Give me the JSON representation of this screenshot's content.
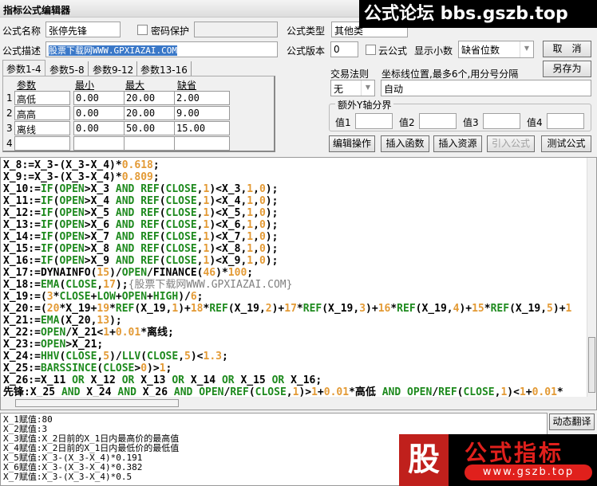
{
  "window": {
    "title": "指标公式编辑器"
  },
  "form": {
    "name_label": "公式名称",
    "name_value": "张停先锋",
    "password_label": "密码保护",
    "password_checked": false,
    "type_label": "公式类型",
    "type_value": "其他类",
    "desc_label": "公式描述",
    "desc_value": "股票下载网WWW.GPXIAZAI.COM",
    "version_label": "公式版本",
    "version_value": "0",
    "cloud_label": "云公式",
    "cloud_checked": false,
    "decimals_label": "显示小数",
    "decimals_value": "缺省位数",
    "cancel_label": "取　消",
    "saveas_label": "另存为",
    "trade_rule_label": "交易法则",
    "trade_rule_value": "无",
    "axis_label": "坐标线位置,最多6个,用分号分隔",
    "axis_value": "自动",
    "yaxis_group_label": "额外Y轴分界",
    "yaxis_values": [
      {
        "label": "值1",
        "value": ""
      },
      {
        "label": "值2",
        "value": ""
      },
      {
        "label": "值3",
        "value": ""
      },
      {
        "label": "值4",
        "value": ""
      }
    ]
  },
  "tabs": [
    "参数1-4",
    "参数5-8",
    "参数9-12",
    "参数13-16"
  ],
  "params": {
    "headers": [
      "参数",
      "最小",
      "最大",
      "缺省"
    ],
    "rows": [
      {
        "no": "1",
        "name": "高低",
        "min": "0.00",
        "max": "20.00",
        "def": "2.00"
      },
      {
        "no": "2",
        "name": "高高",
        "min": "0.00",
        "max": "20.00",
        "def": "9.00"
      },
      {
        "no": "3",
        "name": "离线",
        "min": "0.00",
        "max": "50.00",
        "def": "15.00"
      },
      {
        "no": "4",
        "name": "",
        "min": "",
        "max": "",
        "def": ""
      }
    ]
  },
  "toolbar": [
    "编辑操作",
    "插入函数",
    "插入资源",
    "引入公式",
    "测试公式"
  ],
  "code_lines": [
    "X_8:=X_3-(X_3-X_4)*0.618;",
    "X_9:=X_3-(X_3-X_4)*0.809;",
    "X_10:=IF(OPEN>X_3 AND REF(CLOSE,1)<X_3,1,0);",
    "X_11:=IF(OPEN>X_4 AND REF(CLOSE,1)<X_4,1,0);",
    "X_12:=IF(OPEN>X_5 AND REF(CLOSE,1)<X_5,1,0);",
    "X_13:=IF(OPEN>X_6 AND REF(CLOSE,1)<X_6,1,0);",
    "X_14:=IF(OPEN>X_7 AND REF(CLOSE,1)<X_7,1,0);",
    "X_15:=IF(OPEN>X_8 AND REF(CLOSE,1)<X_8,1,0);",
    "X_16:=IF(OPEN>X_9 AND REF(CLOSE,1)<X_9,1,0);",
    "X_17:=DYNAINFO(15)/OPEN/FINANCE(46)*100;",
    "X_18:=EMA(CLOSE,17);{股票下载网WWW.GPXIAZAI.COM}",
    "X_19:=(3*CLOSE+LOW+OPEN+HIGH)/6;",
    "X_20:=(20*X_19+19*REF(X_19,1)+18*REF(X_19,2)+17*REF(X_19,3)+16*REF(X_19,4)+15*REF(X_19,5)+1",
    "X_21:=EMA(X_20,13);",
    "X_22:=OPEN/X_21<1+0.01*离线;",
    "X_23:=OPEN>X_21;",
    "X_24:=HHV(CLOSE,5)/LLV(CLOSE,5)<1.3;",
    "X_25:=BARSSINCE(CLOSE>0)>1;",
    "X_26:=X_11 OR X_12 OR X_13 OR X_14 OR X_15 OR X_16;",
    "先锋:X_25 AND X_24 AND X_26 AND OPEN/REF(CLOSE,1)>1+0.01*高低 AND OPEN/REF(CLOSE,1)<1+0.01*"
  ],
  "output_lines": [
    "X_1赋值:80",
    "X_2赋值:3",
    "X_3赋值:X_2日前的X_1日内最高价的最高值",
    "X_4赋值:X_2日前的X_1日内最低价的最低值",
    "X_5赋值:X_3-(X_3-X_4)*0.191",
    "X_6赋值:X_3-(X_3-X_4)*0.382",
    "X_7赋值:X_3-(X_3-X_4)*0.5"
  ],
  "translate_button": "动态翻译",
  "watermarks": {
    "top": "公式论坛 bbs.gszb.top",
    "logo_char": "股",
    "logo_title": "公式指标",
    "logo_url": "www.gszb.top"
  },
  "colors": {
    "keyword": "#1e8a1e",
    "number": "#e39a35",
    "selection": "#3a78c8"
  }
}
